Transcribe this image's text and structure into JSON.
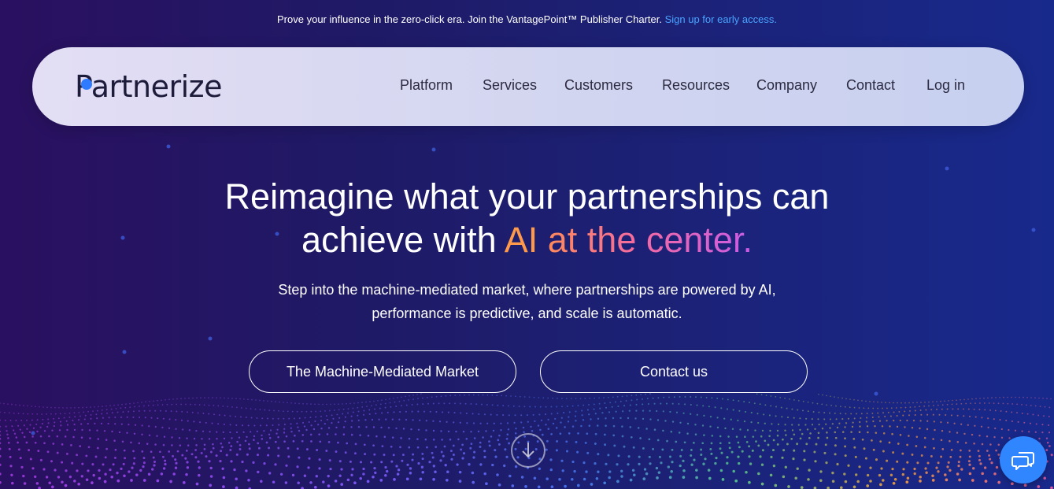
{
  "announcement": {
    "text": "Prove your influence in the zero-click era. Join the VantagePoint™ Publisher Charter.",
    "link": "Sign up for early access."
  },
  "nav": {
    "logo_text": "Partnerize",
    "items": [
      "Platform",
      "Services",
      "Customers",
      "Resources",
      "Company",
      "Contact",
      "Log in"
    ]
  },
  "hero": {
    "title_line1": "Reimagine what your partnerships can",
    "title_line2_prefix": "achieve with",
    "title_highlight_ai": "AI",
    "title_highlight_rest": "at the center.",
    "subtitle_line1": "Step into the machine-mediated market, where partnerships are powered by AI,",
    "subtitle_line2": "performance is predictive, and scale is automatic.",
    "buttons": [
      "The Machine-Mediated Market",
      "Contact us"
    ]
  },
  "icons": {
    "scroll": "arrow-down-icon",
    "chat": "chat-icon"
  },
  "colors": {
    "link": "#4aa3ff",
    "chat_button": "#2f86ff",
    "nav_bg": "#d6d6f1",
    "highlight_orange": "#ff9a4a",
    "highlight_purple": "#c85ce6"
  }
}
